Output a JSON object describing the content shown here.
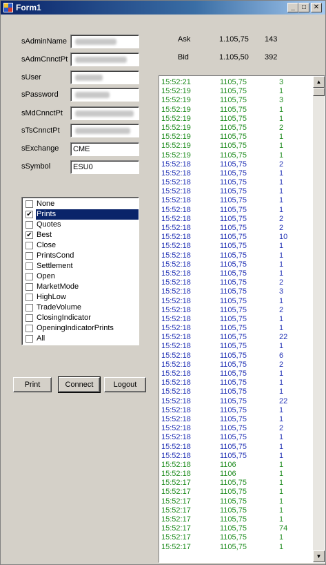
{
  "window": {
    "title": "Form1",
    "min": "_",
    "max": "□",
    "close": "✕"
  },
  "colors": {
    "green": "#1e8c1e",
    "blue": "#1f2fb4"
  },
  "fields": [
    {
      "label": "sAdminName",
      "value": "",
      "blurred": true
    },
    {
      "label": "sAdmCnnctPt",
      "value": "",
      "blurred": true
    },
    {
      "label": "sUser",
      "value": "",
      "blurred": true
    },
    {
      "label": "sPassword",
      "value": "",
      "blurred": true
    },
    {
      "label": "sMdCnnctPt",
      "value": "",
      "blurred": true
    },
    {
      "label": "sTsCnnctPt",
      "value": "",
      "blurred": true
    },
    {
      "label": "sExchange",
      "value": "CME",
      "blurred": false
    },
    {
      "label": "sSymbol",
      "value": "ESU0",
      "blurred": false
    }
  ],
  "options": [
    {
      "label": "None",
      "checked": false,
      "selected": false
    },
    {
      "label": "Prints",
      "checked": true,
      "selected": true
    },
    {
      "label": "Quotes",
      "checked": false,
      "selected": false
    },
    {
      "label": "Best",
      "checked": true,
      "selected": false
    },
    {
      "label": "Close",
      "checked": false,
      "selected": false
    },
    {
      "label": "PrintsCond",
      "checked": false,
      "selected": false
    },
    {
      "label": "Settlement",
      "checked": false,
      "selected": false
    },
    {
      "label": "Open",
      "checked": false,
      "selected": false
    },
    {
      "label": "MarketMode",
      "checked": false,
      "selected": false
    },
    {
      "label": "HighLow",
      "checked": false,
      "selected": false
    },
    {
      "label": "TradeVolume",
      "checked": false,
      "selected": false
    },
    {
      "label": "ClosingIndicator",
      "checked": false,
      "selected": false
    },
    {
      "label": "OpeningIndicatorPrints",
      "checked": false,
      "selected": false
    },
    {
      "label": "All",
      "checked": false,
      "selected": false
    }
  ],
  "buttons": {
    "print": "Print",
    "connect": "Connect",
    "logout": "Logout"
  },
  "quote": {
    "ask_label": "Ask",
    "ask_price": "1.105,75",
    "ask_size": "143",
    "bid_label": "Bid",
    "bid_price": "1.105,50",
    "bid_size": "392"
  },
  "log": [
    [
      "15:52:21",
      "1105,75",
      "3",
      "green"
    ],
    [
      "15:52:19",
      "1105,75",
      "1",
      "green"
    ],
    [
      "15:52:19",
      "1105,75",
      "3",
      "green"
    ],
    [
      "15:52:19",
      "1105,75",
      "1",
      "green"
    ],
    [
      "15:52:19",
      "1105,75",
      "1",
      "green"
    ],
    [
      "15:52:19",
      "1105,75",
      "2",
      "green"
    ],
    [
      "15:52:19",
      "1105,75",
      "1",
      "green"
    ],
    [
      "15:52:19",
      "1105,75",
      "1",
      "green"
    ],
    [
      "15:52:19",
      "1105,75",
      "1",
      "green"
    ],
    [
      "15:52:18",
      "1105,75",
      "2",
      "blue"
    ],
    [
      "15:52:18",
      "1105,75",
      "1",
      "blue"
    ],
    [
      "15:52:18",
      "1105,75",
      "1",
      "blue"
    ],
    [
      "15:52:18",
      "1105,75",
      "1",
      "blue"
    ],
    [
      "15:52:18",
      "1105,75",
      "1",
      "blue"
    ],
    [
      "15:52:18",
      "1105,75",
      "1",
      "blue"
    ],
    [
      "15:52:18",
      "1105,75",
      "2",
      "blue"
    ],
    [
      "15:52:18",
      "1105,75",
      "2",
      "blue"
    ],
    [
      "15:52:18",
      "1105,75",
      "10",
      "blue"
    ],
    [
      "15:52:18",
      "1105,75",
      "1",
      "blue"
    ],
    [
      "15:52:18",
      "1105,75",
      "1",
      "blue"
    ],
    [
      "15:52:18",
      "1105,75",
      "1",
      "blue"
    ],
    [
      "15:52:18",
      "1105,75",
      "1",
      "blue"
    ],
    [
      "15:52:18",
      "1105,75",
      "2",
      "blue"
    ],
    [
      "15:52:18",
      "1105,75",
      "3",
      "blue"
    ],
    [
      "15:52:18",
      "1105,75",
      "1",
      "blue"
    ],
    [
      "15:52:18",
      "1105,75",
      "2",
      "blue"
    ],
    [
      "15:52:18",
      "1105,75",
      "1",
      "blue"
    ],
    [
      "15:52:18",
      "1105,75",
      "1",
      "blue"
    ],
    [
      "15:52:18",
      "1105,75",
      "22",
      "blue"
    ],
    [
      "15:52:18",
      "1105,75",
      "1",
      "blue"
    ],
    [
      "15:52:18",
      "1105,75",
      "6",
      "blue"
    ],
    [
      "15:52:18",
      "1105,75",
      "2",
      "blue"
    ],
    [
      "15:52:18",
      "1105,75",
      "1",
      "blue"
    ],
    [
      "15:52:18",
      "1105,75",
      "1",
      "blue"
    ],
    [
      "15:52:18",
      "1105,75",
      "1",
      "blue"
    ],
    [
      "15:52:18",
      "1105,75",
      "22",
      "blue"
    ],
    [
      "15:52:18",
      "1105,75",
      "1",
      "blue"
    ],
    [
      "15:52:18",
      "1105,75",
      "1",
      "blue"
    ],
    [
      "15:52:18",
      "1105,75",
      "2",
      "blue"
    ],
    [
      "15:52:18",
      "1105,75",
      "1",
      "blue"
    ],
    [
      "15:52:18",
      "1105,75",
      "1",
      "blue"
    ],
    [
      "15:52:18",
      "1105,75",
      "1",
      "blue"
    ],
    [
      "15:52:18",
      "1106",
      "1",
      "green"
    ],
    [
      "15:52:18",
      "1106",
      "1",
      "green"
    ],
    [
      "15:52:17",
      "1105,75",
      "1",
      "green"
    ],
    [
      "15:52:17",
      "1105,75",
      "1",
      "green"
    ],
    [
      "15:52:17",
      "1105,75",
      "1",
      "green"
    ],
    [
      "15:52:17",
      "1105,75",
      "1",
      "green"
    ],
    [
      "15:52:17",
      "1105,75",
      "1",
      "green"
    ],
    [
      "15:52:17",
      "1105,75",
      "74",
      "green"
    ],
    [
      "15:52:17",
      "1105,75",
      "1",
      "green"
    ],
    [
      "15:52:17",
      "1105,75",
      "1",
      "green"
    ]
  ]
}
